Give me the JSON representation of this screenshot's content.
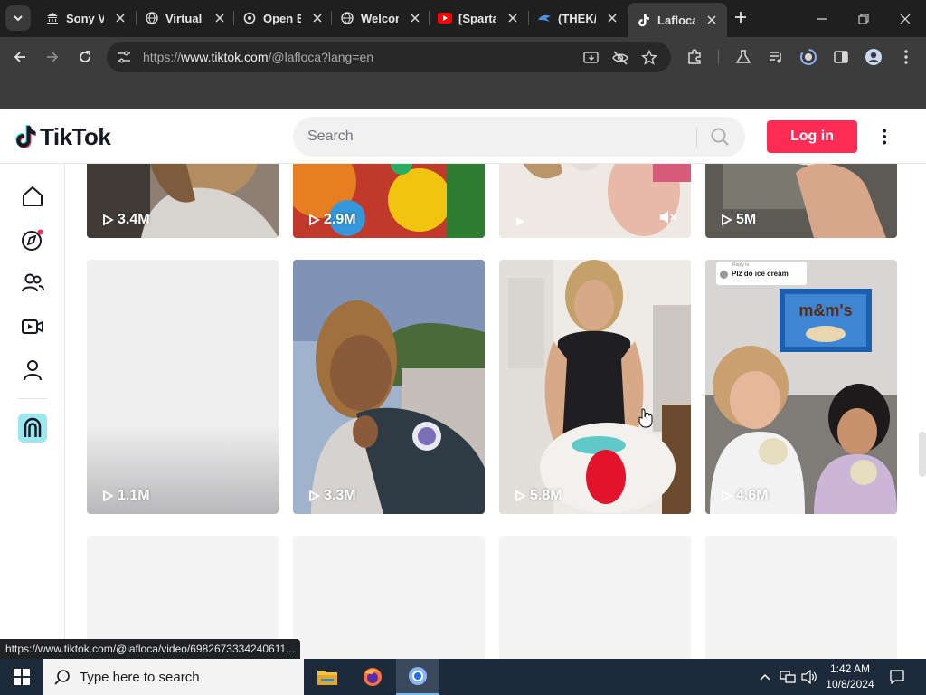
{
  "browser": {
    "tabs": [
      {
        "title": "Sony V",
        "icon": "bank-icon"
      },
      {
        "title": "Virtual",
        "icon": "globe-icon"
      },
      {
        "title": "Open E",
        "icon": "openai-icon"
      },
      {
        "title": "Welcon",
        "icon": "globe-icon"
      },
      {
        "title": "[Sparta",
        "icon": "youtube-icon"
      },
      {
        "title": "(THEK/",
        "icon": "arrow-icon"
      },
      {
        "title": "Lafloca",
        "icon": "tiktok-icon"
      }
    ],
    "url_prefix": "https://",
    "url_host": "www.tiktok.com",
    "url_path": "/@lafloca?lang=en"
  },
  "tiktok": {
    "logo_text": "TikTok",
    "search_placeholder": "Search",
    "login_label": "Log in"
  },
  "videos": {
    "row1": [
      {
        "views": "3.4M"
      },
      {
        "views": "2.9M"
      },
      {
        "views": ""
      },
      {
        "views": "5M"
      }
    ],
    "row2": [
      {
        "views": "1.1M"
      },
      {
        "views": "3.3M"
      },
      {
        "views": "5.8M"
      },
      {
        "views": "4.6M",
        "comment_reply": "Reply to",
        "comment_text": "Plz do ice cream"
      }
    ]
  },
  "status_url": "https://www.tiktok.com/@lafloca/video/6982673334240611...",
  "taskbar": {
    "search_placeholder": "Type here to search",
    "time": "1:42 AM",
    "date": "10/8/2024"
  }
}
